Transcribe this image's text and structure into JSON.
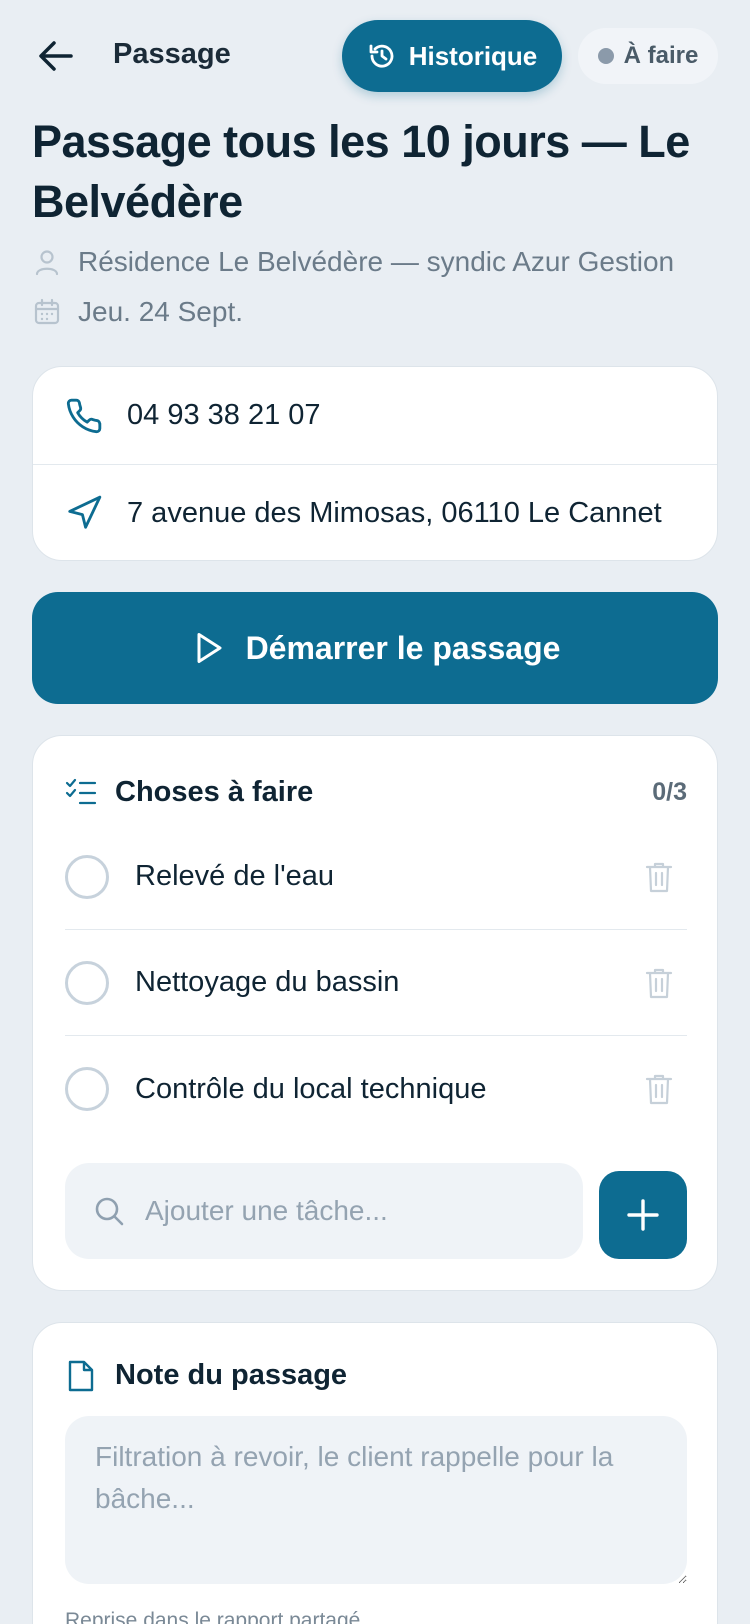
{
  "header": {
    "title": "Passage",
    "history_label": "Historique",
    "status_label": "À faire"
  },
  "page": {
    "title": "Passage tous les 10 jours — Le Belvédère",
    "client": "Résidence Le Belvédère — syndic Azur Gestion",
    "date": "Jeu. 24 Sept."
  },
  "contact": {
    "phone": "04 93 38 21 07",
    "address": "7 avenue des Mimosas, 06110 Le Cannet"
  },
  "start_button": {
    "label": "Démarrer le passage"
  },
  "tasks": {
    "title": "Choses à faire",
    "count": "0/3",
    "items": [
      {
        "label": "Relevé de l'eau"
      },
      {
        "label": "Nettoyage du bassin"
      },
      {
        "label": "Contrôle du local technique"
      }
    ],
    "add_placeholder": "Ajouter une tâche..."
  },
  "note": {
    "title": "Note du passage",
    "placeholder": "Filtration à revoir, le client rappelle pour la bâche...",
    "footnote": "Reprise dans le rapport partagé"
  },
  "colors": {
    "accent": "#0d6c91",
    "background": "#e9eef3",
    "text": "#0f2433",
    "muted": "#6b7b89"
  },
  "icons": {
    "back": "arrow-left-icon",
    "history": "history-clock-icon",
    "user": "user-icon",
    "calendar": "calendar-icon",
    "phone": "phone-icon",
    "navigation": "navigation-arrow-icon",
    "play": "play-icon",
    "checklist": "checklist-icon",
    "trash": "trash-icon",
    "search": "search-icon",
    "plus": "plus-icon",
    "document": "document-icon"
  }
}
